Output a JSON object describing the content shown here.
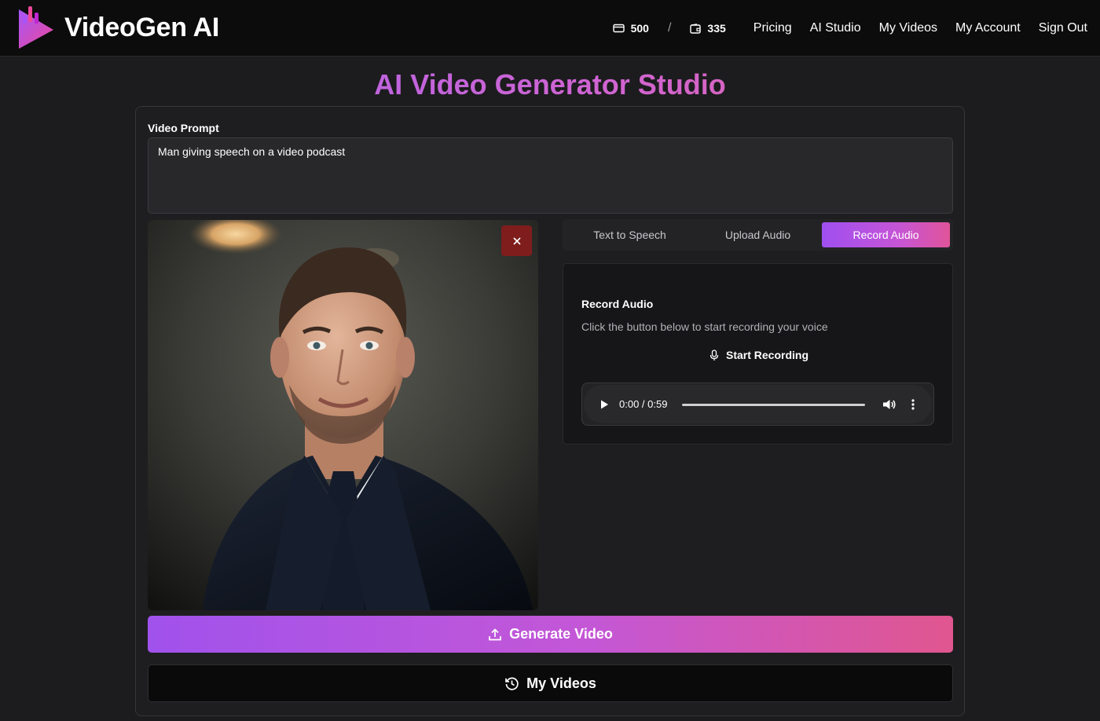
{
  "header": {
    "brand": "VideoGen AI",
    "credits": [
      {
        "icon": "credit-card-icon",
        "value": "500"
      },
      {
        "icon": "wallet-icon",
        "value": "335"
      }
    ],
    "separator": "/",
    "nav": [
      "Pricing",
      "AI Studio",
      "My Videos",
      "My Account",
      "Sign Out"
    ]
  },
  "page": {
    "title": "AI Video Generator Studio"
  },
  "prompt": {
    "label": "Video Prompt",
    "value": "Man giving speech on a video podcast"
  },
  "image": {
    "remove_icon": "close-icon",
    "subject": "portrait photo of smiling man in dark suit and tie"
  },
  "tabs": {
    "items": [
      "Text to Speech",
      "Upload Audio",
      "Record Audio"
    ],
    "active": "Record Audio"
  },
  "record": {
    "title": "Record Audio",
    "description": "Click the button below to start recording your voice",
    "start_label": "Start Recording",
    "start_icon": "microphone-icon"
  },
  "audio_player": {
    "time": "0:00 / 0:59",
    "progress": 0
  },
  "actions": {
    "generate_label": "Generate Video",
    "generate_icon": "upload-icon",
    "my_videos_label": "My Videos",
    "my_videos_icon": "history-icon"
  },
  "colors": {
    "accent_start": "#a052ec",
    "accent_end": "#e0568f",
    "background": "#1c1c1e",
    "danger": "#7f1d1d"
  }
}
